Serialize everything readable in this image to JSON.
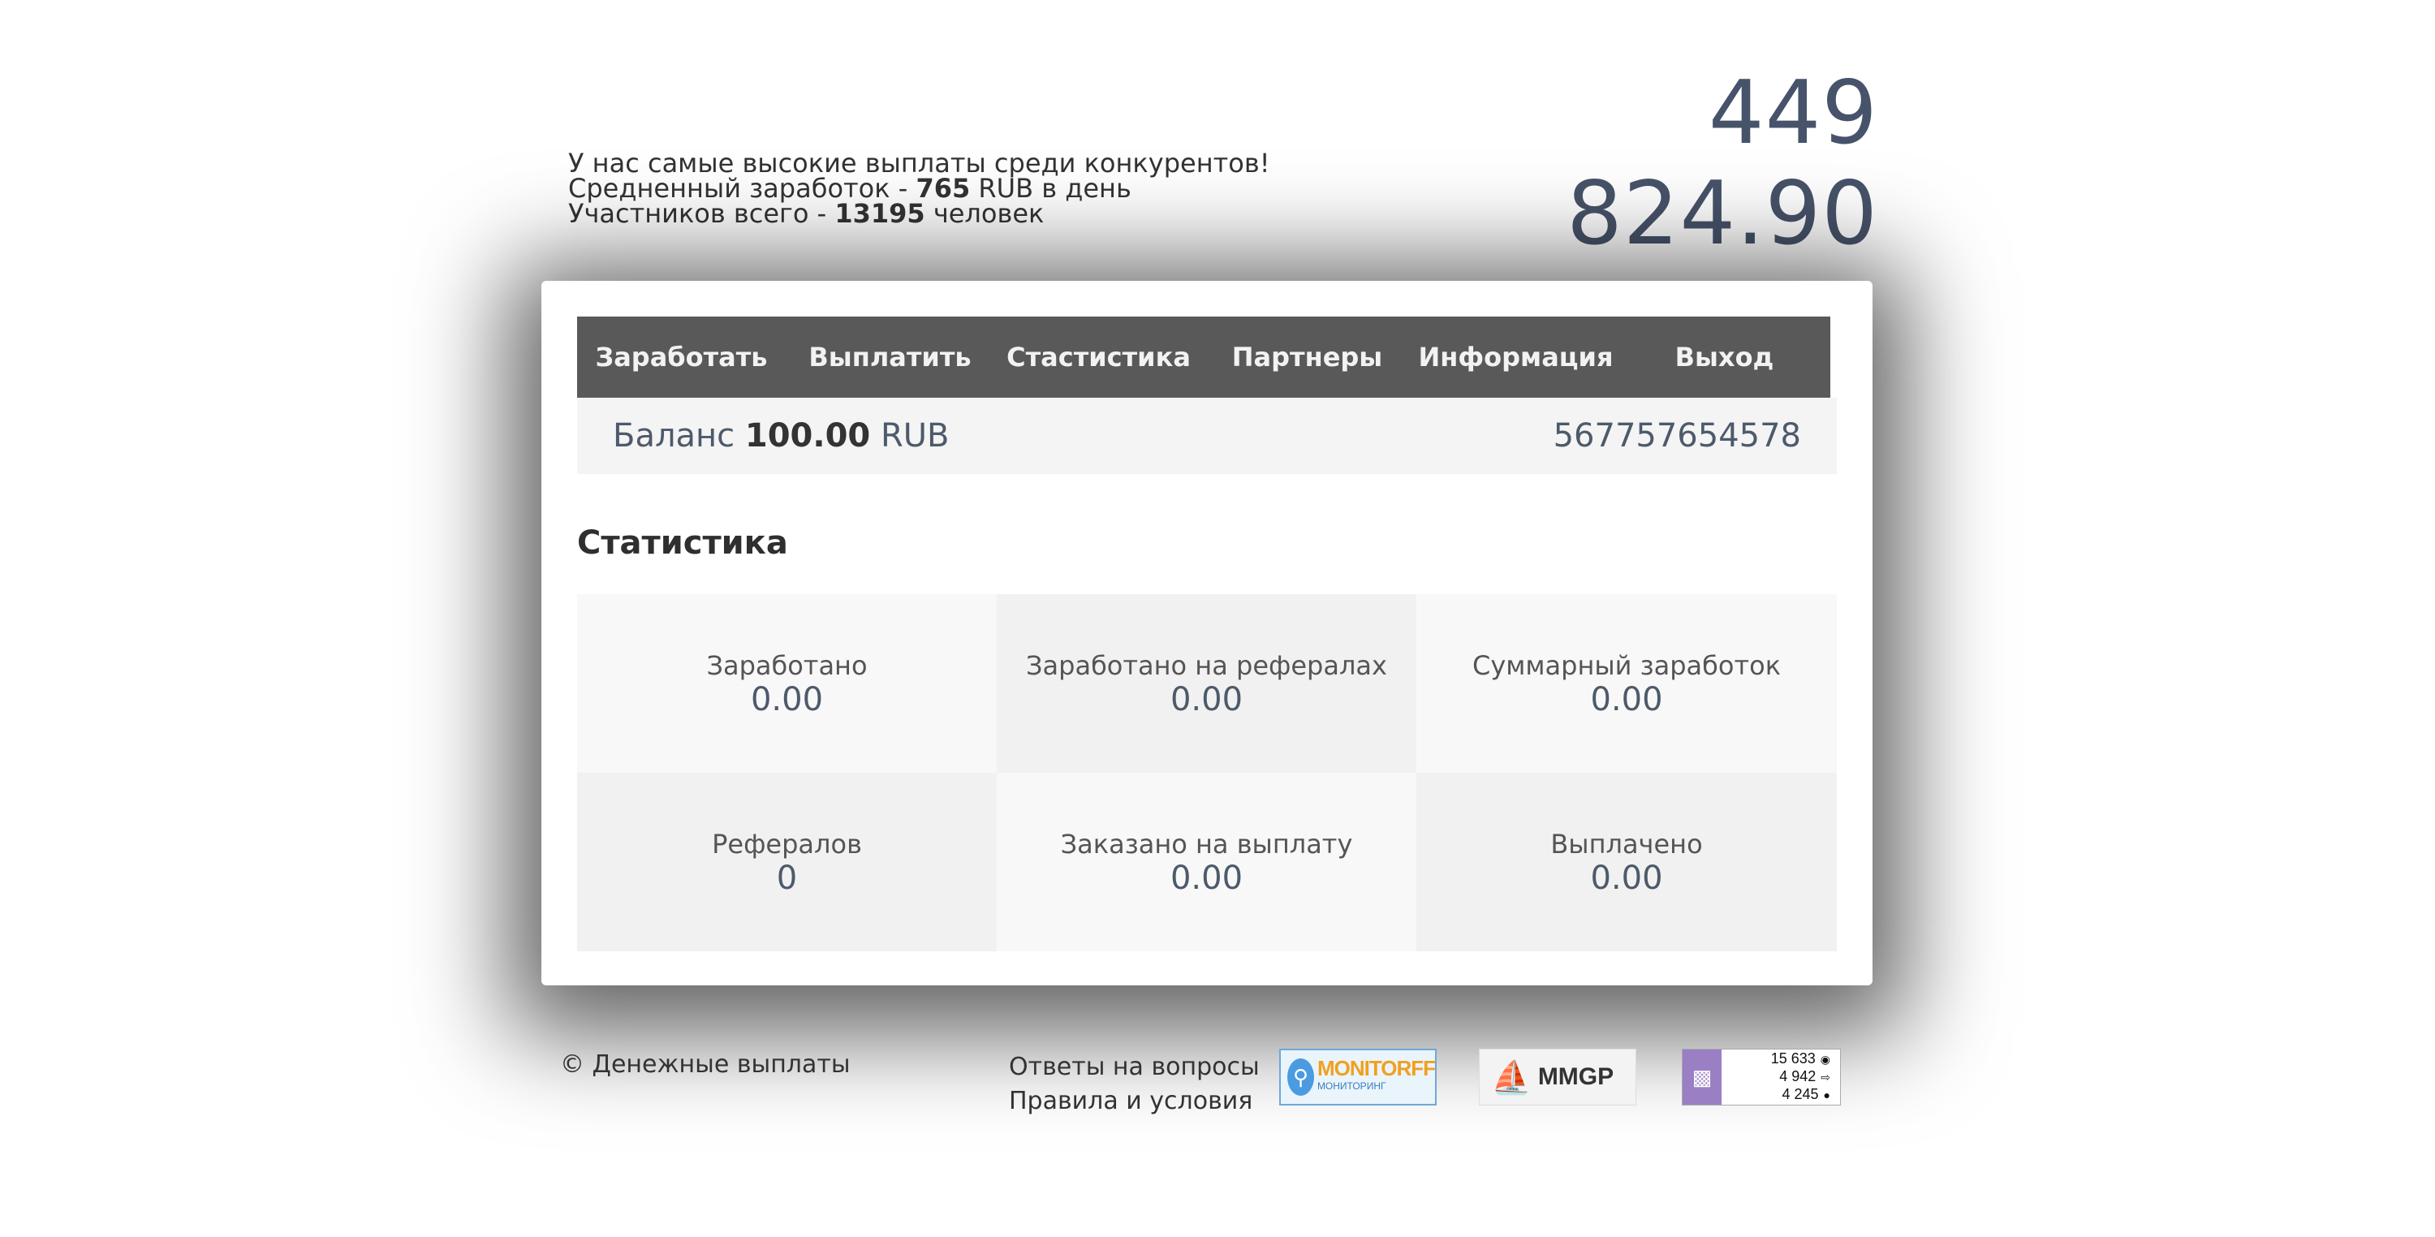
{
  "counter": "449 824.90",
  "promo": {
    "line1": "У нас самые высокие выплаты среди конкурентов!",
    "line2_prefix": "Средненный заработок - ",
    "line2_value": "765",
    "line2_suffix": " RUB в день",
    "line3_prefix": "Участников всего - ",
    "line3_value": "13195",
    "line3_suffix": " человек"
  },
  "nav": [
    {
      "label": "Заработать"
    },
    {
      "label": "Выплатить"
    },
    {
      "label": "Стастистика"
    },
    {
      "label": "Партнеры"
    },
    {
      "label": "Информация"
    },
    {
      "label": "Выход"
    }
  ],
  "balance": {
    "label": "Баланс ",
    "amount": "100.00",
    "currency": " RUB",
    "account_id": "567757654578"
  },
  "stats_title": "Статистика",
  "stats": [
    {
      "label": "Заработано",
      "value": "0.00"
    },
    {
      "label": "Заработано на рефералах",
      "value": "0.00"
    },
    {
      "label": "Суммарный заработок",
      "value": "0.00"
    },
    {
      "label": "Рефералов",
      "value": "0"
    },
    {
      "label": "Заказано на выплату",
      "value": "0.00"
    },
    {
      "label": "Выплачено",
      "value": "0.00"
    }
  ],
  "footer": {
    "copyright": "© Денежные выплаты",
    "links": [
      "Ответы на вопросы",
      "Правила и условия"
    ]
  },
  "badges": {
    "monitor": {
      "title": "MONITORFF",
      "subtitle": "МОНИТОРИНГ"
    },
    "mmgp": {
      "title": "MMGP"
    },
    "liveinternet": {
      "views": "15 633",
      "visitors": "4 942",
      "hosts": "4 245"
    }
  },
  "colors": {
    "nav_bg": "#595959",
    "counter": "#47536a",
    "accent_text": "#4d5a6b"
  }
}
